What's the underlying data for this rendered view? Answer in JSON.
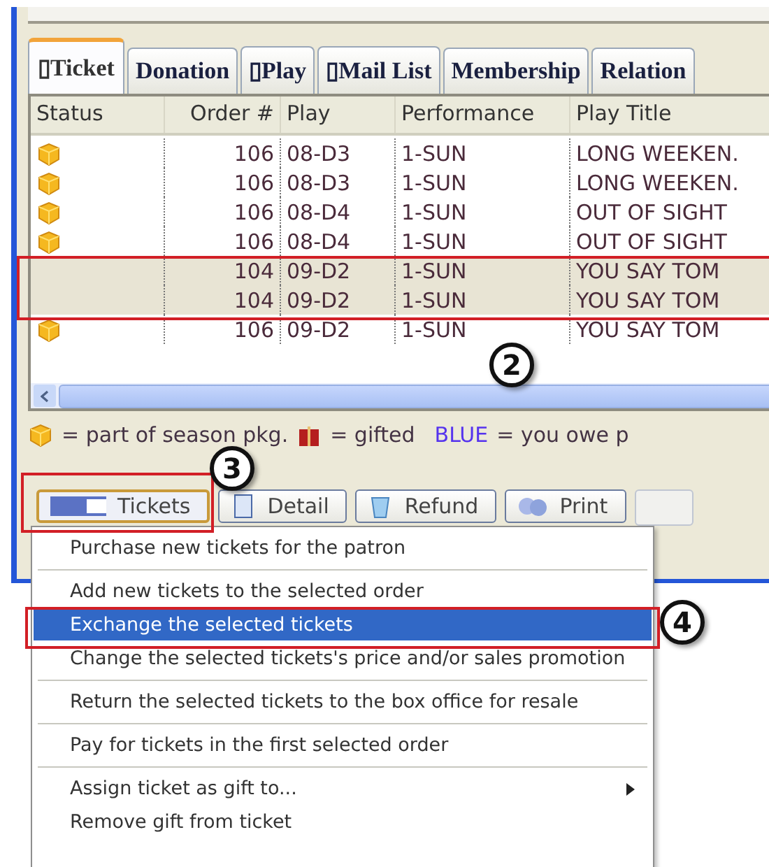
{
  "tabs": [
    {
      "label": "▯Ticket",
      "selected": true
    },
    {
      "label": "Donation",
      "selected": false
    },
    {
      "label": "▯Play",
      "selected": false
    },
    {
      "label": "▯Mail List",
      "selected": false
    },
    {
      "label": "Membership",
      "selected": false
    },
    {
      "label": "Relation",
      "selected": false
    }
  ],
  "table": {
    "columns": [
      "Status",
      "Order #",
      "Play",
      "Performance",
      "Play Title"
    ],
    "rows": [
      {
        "season_pkg": true,
        "selected": false,
        "cells": [
          "",
          "106",
          "08-D3",
          "1-SUN",
          "LONG WEEKEN."
        ]
      },
      {
        "season_pkg": true,
        "selected": false,
        "cells": [
          "",
          "106",
          "08-D3",
          "1-SUN",
          "LONG WEEKEN."
        ]
      },
      {
        "season_pkg": true,
        "selected": false,
        "cells": [
          "",
          "106",
          "08-D4",
          "1-SUN",
          "OUT OF SIGHT"
        ]
      },
      {
        "season_pkg": true,
        "selected": false,
        "cells": [
          "",
          "106",
          "08-D4",
          "1-SUN",
          "OUT OF SIGHT"
        ]
      },
      {
        "season_pkg": false,
        "selected": true,
        "cells": [
          "",
          "104",
          "09-D2",
          "1-SUN",
          "YOU SAY TOM"
        ]
      },
      {
        "season_pkg": false,
        "selected": true,
        "cells": [
          "",
          "104",
          "09-D2",
          "1-SUN",
          "YOU SAY TOM"
        ]
      },
      {
        "season_pkg": true,
        "selected": false,
        "cells": [
          "",
          "106",
          "09-D2",
          "1-SUN",
          "YOU SAY TOM"
        ]
      }
    ]
  },
  "legend": {
    "season_text": "= part of season pkg.",
    "gifted_text": "= gifted",
    "blue_word": "BLUE",
    "owe_text": "= you owe p"
  },
  "toolbar": {
    "buttons": [
      {
        "kind": "tickets",
        "label": "Tickets",
        "pressed": true
      },
      {
        "kind": "detail",
        "label": "Detail",
        "pressed": false
      },
      {
        "kind": "refund",
        "label": "Refund",
        "pressed": false
      },
      {
        "kind": "print",
        "label": "Print",
        "pressed": false
      }
    ]
  },
  "menu": {
    "items": [
      {
        "kind": "item",
        "label": "Purchase new tickets for the patron",
        "highlighted": false,
        "submenu": false
      },
      {
        "kind": "separator"
      },
      {
        "kind": "item",
        "label": "Add new tickets to the selected order",
        "highlighted": false,
        "submenu": false
      },
      {
        "kind": "item",
        "label": "Exchange the selected tickets",
        "highlighted": true,
        "submenu": false
      },
      {
        "kind": "item",
        "label": "Change the selected tickets's price and/or sales promotion",
        "highlighted": false,
        "submenu": false
      },
      {
        "kind": "separator"
      },
      {
        "kind": "item",
        "label": "Return the selected tickets to the box office for resale",
        "highlighted": false,
        "submenu": false
      },
      {
        "kind": "separator"
      },
      {
        "kind": "item",
        "label": "Pay for tickets in the first selected order",
        "highlighted": false,
        "submenu": false
      },
      {
        "kind": "separator"
      },
      {
        "kind": "item",
        "label": "Assign ticket as gift to...",
        "highlighted": false,
        "submenu": true
      },
      {
        "kind": "item",
        "label": "Remove gift from ticket",
        "highlighted": false,
        "submenu": false
      }
    ]
  },
  "callouts": [
    {
      "number": "2"
    },
    {
      "number": "3"
    },
    {
      "number": "4"
    }
  ]
}
